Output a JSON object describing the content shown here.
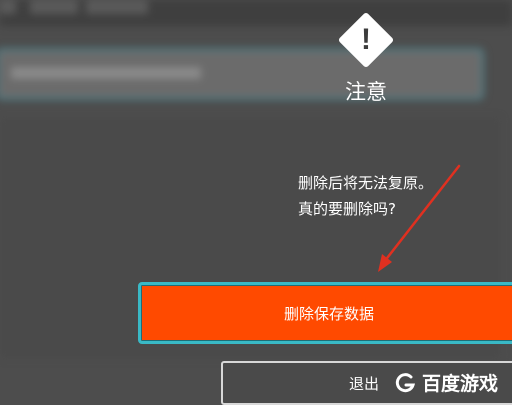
{
  "dialog": {
    "title": "注意",
    "message_line1": "删除后将无法复原。",
    "message_line2": "真的要删除吗?",
    "delete_label": "删除保存数据",
    "exit_label": "退出"
  },
  "watermark": {
    "text": "百度游戏"
  },
  "colors": {
    "delete_button": "#ff4a00",
    "focus_border": "#39b9c6",
    "arrow": "#e03020"
  }
}
